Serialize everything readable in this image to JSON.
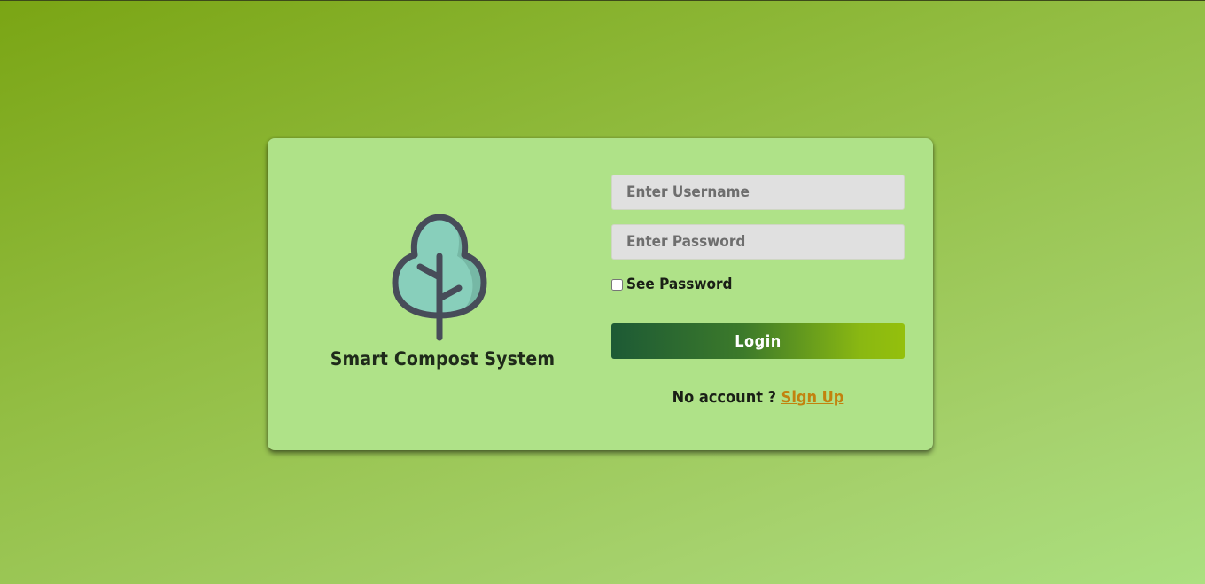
{
  "brand": {
    "title": "Smart Compost System",
    "logo_icon": "tree-icon"
  },
  "form": {
    "username_placeholder": "Enter Username",
    "username_value": "",
    "password_placeholder": "Enter Password",
    "password_value": "",
    "see_password_label": "See Password",
    "see_password_checked": false,
    "login_label": "Login",
    "no_account_text": "No account ?",
    "signup_link": "Sign Up"
  },
  "colors": {
    "card_background": "#afe288",
    "link": "#c2820e",
    "tree_fill": "#88cfbb",
    "tree_outline": "#474c59"
  }
}
